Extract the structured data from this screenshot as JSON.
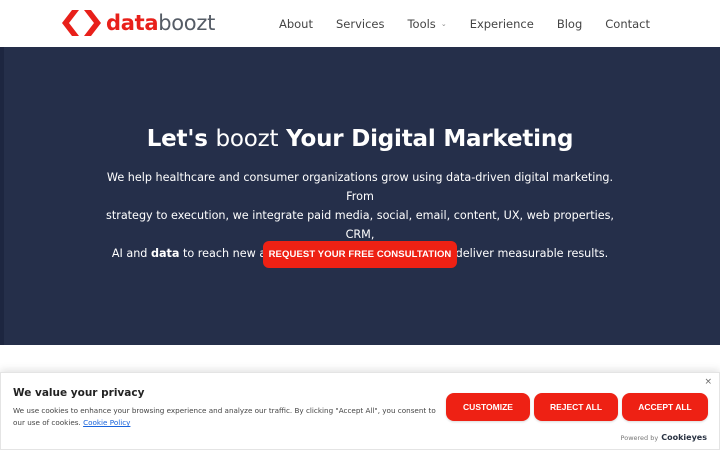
{
  "logo": {
    "part1": "data",
    "part2": "boozt",
    "icon": "databoozt-brackets-icon",
    "colors": {
      "accent": "#e8201a",
      "text": "#555c66"
    }
  },
  "nav": {
    "items": [
      {
        "label": "About"
      },
      {
        "label": "Services"
      },
      {
        "label": "Tools",
        "has_dropdown": true,
        "icon": "chevron-down-icon"
      },
      {
        "label": "Experience"
      },
      {
        "label": "Blog"
      },
      {
        "label": "Contact"
      }
    ]
  },
  "hero": {
    "title_part1": "Let's ",
    "title_part2": "boozt",
    "title_part3": " Your Digital Marketing",
    "desc_line1": "We help healthcare and consumer organizations grow using data-driven digital marketing. From",
    "desc_line2": "strategy to execution, we integrate paid media, social, email, content, UX, web properties, CRM,",
    "desc_line3_pre": "AI and ",
    "desc_line3_bold": "data",
    "desc_line3_post": " to reach new audiences, engage customers and deliver measurable results.",
    "cta_label": "REQUEST YOUR FREE CONSULTATION",
    "colors": {
      "background": "#252f4a",
      "cta": "#ee2114"
    }
  },
  "cookie_banner": {
    "title": "We value your privacy",
    "text": "We use cookies to enhance your browsing experience and analyze our traffic. By clicking \"Accept All\", you consent to our use of cookies.",
    "link_label": "Cookie Policy",
    "buttons": {
      "customize": "CUSTOMIZE",
      "reject": "REJECT ALL",
      "accept": "ACCEPT ALL"
    },
    "close_label": "×",
    "powered_by": "Powered by",
    "powered_brand": "Cookieyes"
  }
}
